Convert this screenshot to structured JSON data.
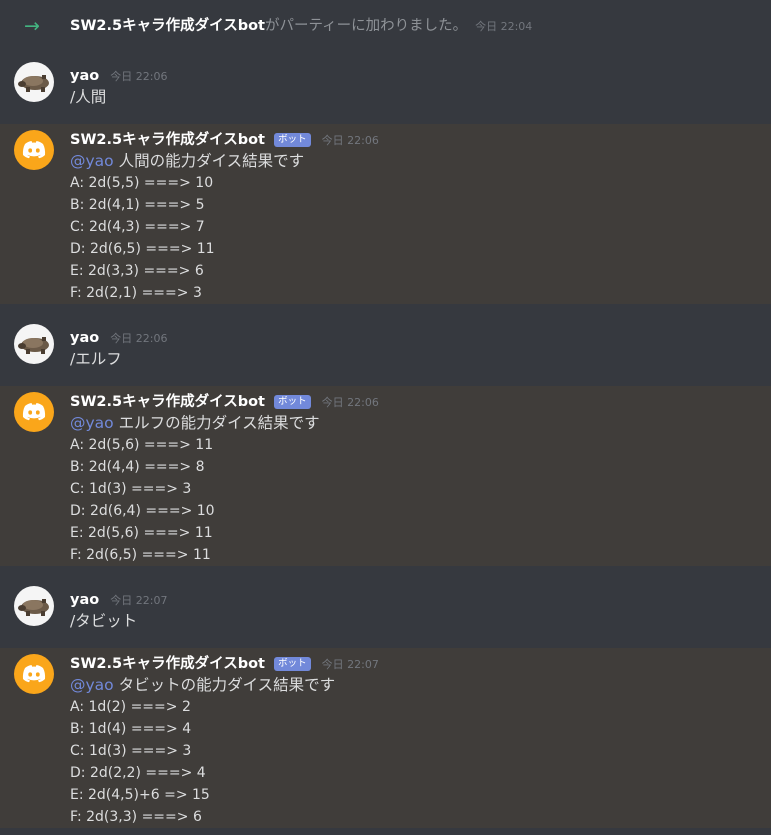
{
  "system_message": {
    "arrow": "→",
    "name": "SW2.5キャラ作成ダイスbot",
    "text": "がパーティーに加わりました。",
    "time": "今日 22:04"
  },
  "messages": [
    {
      "user": {
        "name": "yao",
        "time": "今日 22:06",
        "command": "/人間"
      },
      "bot": {
        "name": "SW2.5キャラ作成ダイスbot",
        "tag": "ボット",
        "time": "今日 22:06",
        "mention": "@yao",
        "title": "人間の能力ダイス結果です",
        "lines": [
          "A: 2d(5,5) ===> 10",
          "B: 2d(4,1) ===> 5",
          "C: 2d(4,3) ===> 7",
          "D: 2d(6,5) ===> 11",
          "E: 2d(3,3) ===> 6",
          "F: 2d(2,1) ===> 3"
        ]
      }
    },
    {
      "user": {
        "name": "yao",
        "time": "今日 22:06",
        "command": "/エルフ"
      },
      "bot": {
        "name": "SW2.5キャラ作成ダイスbot",
        "tag": "ボット",
        "time": "今日 22:06",
        "mention": "@yao",
        "title": "エルフの能力ダイス結果です",
        "lines": [
          "A: 2d(5,6) ===> 11",
          "B: 2d(4,4) ===> 8",
          "C: 1d(3) ===> 3",
          "D: 2d(6,4) ===> 10",
          "E: 2d(5,6) ===> 11",
          "F: 2d(6,5) ===> 11"
        ]
      }
    },
    {
      "user": {
        "name": "yao",
        "time": "今日 22:07",
        "command": "/タビット"
      },
      "bot": {
        "name": "SW2.5キャラ作成ダイスbot",
        "tag": "ボット",
        "time": "今日 22:07",
        "mention": "@yao",
        "title": "タビットの能力ダイス結果です",
        "lines": [
          "A: 1d(2) ===> 2",
          "B: 1d(4) ===> 4",
          "C: 1d(3) ===> 3",
          "D: 2d(2,2) ===> 4",
          "E: 2d(4,5)+6 => 15",
          "F: 2d(3,3) ===> 6"
        ]
      }
    }
  ],
  "colors": {
    "background": "#36393f",
    "bot_highlight": "#403d3a",
    "mention": "#7289da",
    "bot_tag": "#7289da",
    "bot_avatar": "#faa61a",
    "join_arrow": "#43b581"
  }
}
